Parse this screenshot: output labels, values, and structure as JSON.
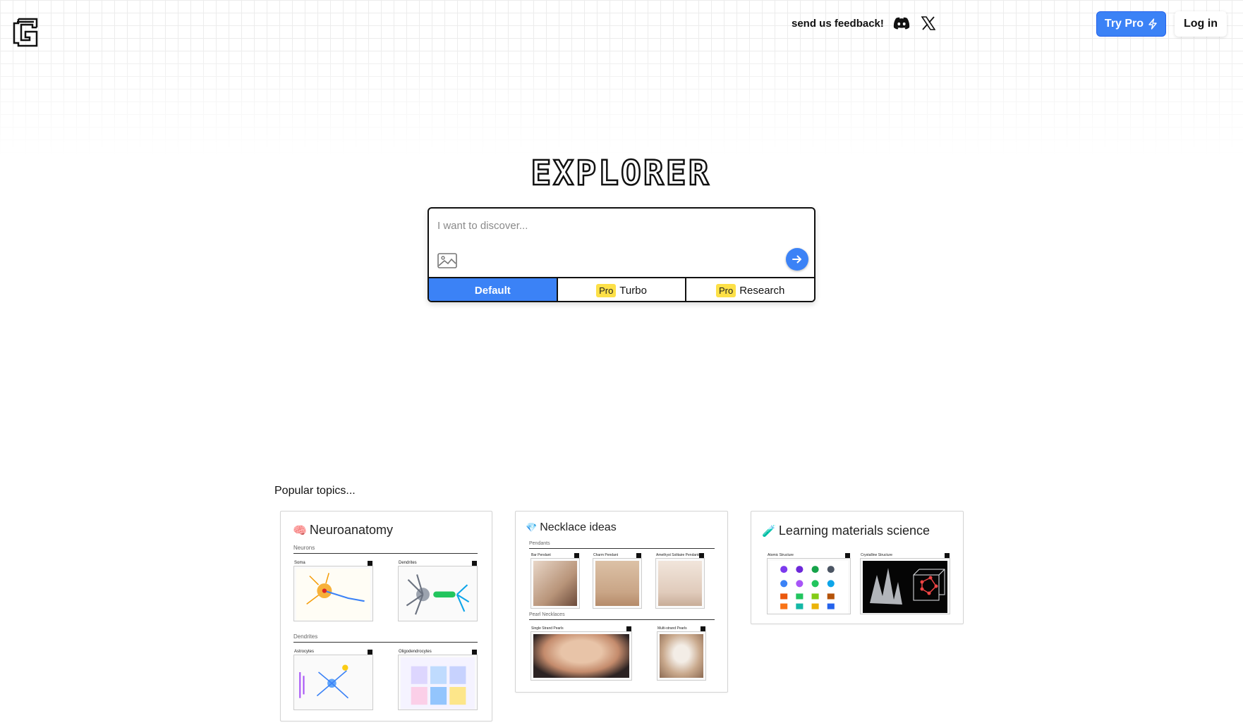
{
  "header": {
    "feedback_text": "send us feedback!",
    "discord_icon": "discord-icon",
    "x_icon": "x-twitter-icon",
    "try_pro_label": "Try Pro",
    "login_label": "Log in"
  },
  "brand": {
    "title": "EXPLORER",
    "accent_color": "#3b82f6",
    "pro_badge_color": "#fde047"
  },
  "search": {
    "placeholder": "I want to discover...",
    "value": "",
    "modes": [
      {
        "label": "Default",
        "badge": "",
        "active": true
      },
      {
        "label": "Turbo",
        "badge": "Pro",
        "active": false
      },
      {
        "label": "Research",
        "badge": "Pro",
        "active": false
      }
    ]
  },
  "popular": {
    "heading": "Popular topics...",
    "cards": [
      {
        "emoji": "🧠",
        "title": "Neuroanatomy",
        "sections": [
          {
            "label": "Neurons",
            "items": [
              "Soma",
              "Dendrites"
            ]
          },
          {
            "label": "Dendrites",
            "items": [
              "Astrocytes",
              "Oligodendrocytes"
            ]
          }
        ]
      },
      {
        "emoji": "💎",
        "title": "Necklace ideas",
        "sections": [
          {
            "label": "Pendants",
            "items": [
              "Bar Pendant",
              "Charm Pendant",
              "Amethyst Solitaire Pendants"
            ]
          },
          {
            "label": "Pearl Necklaces",
            "items": [
              "Single Strand Pearls",
              "Multi-strand Pearls"
            ]
          }
        ]
      },
      {
        "emoji": "🧪",
        "title": "Learning materials science",
        "sections": [
          {
            "label": "",
            "items": [
              "Atomic Structure",
              "Crystalline Structure"
            ]
          }
        ]
      }
    ]
  }
}
